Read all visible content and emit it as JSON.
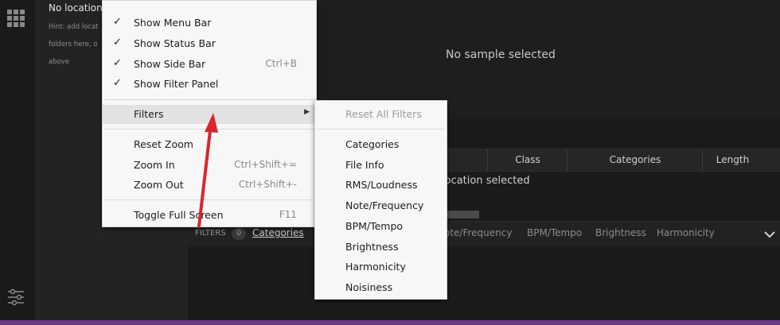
{
  "sidebar": {
    "title": "No locations",
    "hint_line1": "Hint: add locat",
    "hint_line2": "folders here, o",
    "hint_line3": "above"
  },
  "preview": {
    "message": "No sample selected"
  },
  "list": {
    "columns": [
      "Class",
      "Categories",
      "Length"
    ],
    "empty_message": "location selected"
  },
  "filter_bar": {
    "label": "FILTERS",
    "count": "0",
    "tabs": [
      "Categories",
      "Note/Frequency",
      "BPM/Tempo",
      "Brightness",
      "Harmonicity"
    ]
  },
  "context_menu": {
    "items": [
      {
        "label": "Show Menu Bar",
        "checked": true,
        "shortcut": ""
      },
      {
        "label": "Show Status Bar",
        "checked": true,
        "shortcut": ""
      },
      {
        "label": "Show Side Bar",
        "checked": true,
        "shortcut": "Ctrl+B"
      },
      {
        "label": "Show Filter Panel",
        "checked": true,
        "shortcut": ""
      },
      {
        "label": "Filters",
        "checked": false,
        "shortcut": "",
        "submenu": true,
        "highlighted": true
      },
      {
        "label": "Reset Zoom",
        "checked": false,
        "shortcut": ""
      },
      {
        "label": "Zoom In",
        "checked": false,
        "shortcut": "Ctrl+Shift+="
      },
      {
        "label": "Zoom Out",
        "checked": false,
        "shortcut": "Ctrl+Shift+-"
      },
      {
        "label": "Toggle Full Screen",
        "checked": false,
        "shortcut": "F11"
      }
    ]
  },
  "filters_submenu": {
    "reset": "Reset All Filters",
    "items": [
      "Categories",
      "File Info",
      "RMS/Loudness",
      "Note/Frequency",
      "BPM/Tempo",
      "Brightness",
      "Harmonicity",
      "Noisiness"
    ]
  },
  "colors": {
    "accent_bar": "#6b3b87",
    "arrow": "#d9262b"
  }
}
